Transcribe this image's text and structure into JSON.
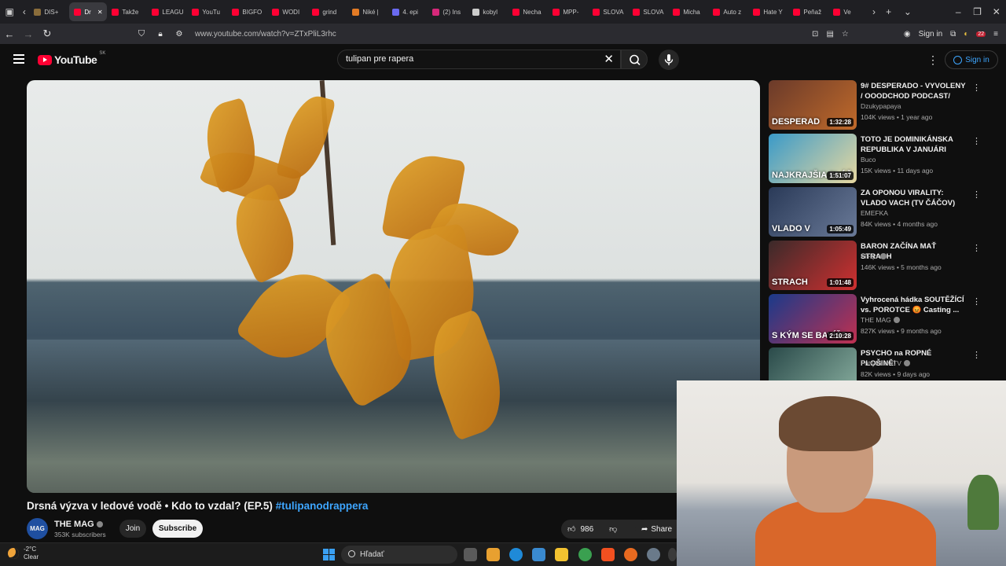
{
  "browser": {
    "tabs": [
      {
        "label": "DIS+",
        "color": "#8a6d3b"
      },
      {
        "label": "Dr",
        "color": "#ff0033",
        "active": true
      },
      {
        "label": "Takže",
        "color": "#ff0033"
      },
      {
        "label": "LEAGU",
        "color": "#ff0033"
      },
      {
        "label": "YouTu",
        "color": "#ff0033"
      },
      {
        "label": "BIGFO",
        "color": "#ff0033"
      },
      {
        "label": "WODI",
        "color": "#ff0033"
      },
      {
        "label": "grind",
        "color": "#ff0033"
      },
      {
        "label": "Niké |",
        "color": "#e37b25"
      },
      {
        "label": "4. epi",
        "color": "#6a6af0"
      },
      {
        "label": "(2) Ins",
        "color": "#d6287a"
      },
      {
        "label": "kobyl",
        "color": "#cccccc"
      },
      {
        "label": "Necha",
        "color": "#ff0033"
      },
      {
        "label": "MPP-",
        "color": "#ff0033"
      },
      {
        "label": "SLOVA",
        "color": "#ff0033"
      },
      {
        "label": "SLOVA",
        "color": "#ff0033"
      },
      {
        "label": "Micha",
        "color": "#ff0033"
      },
      {
        "label": "Auto z",
        "color": "#ff0033"
      },
      {
        "label": "Hate Y",
        "color": "#ff0033"
      },
      {
        "label": "Peňaž",
        "color": "#ff0033"
      },
      {
        "label": "Ve",
        "color": "#ff0033"
      }
    ],
    "url": "www.youtube.com/watch?v=ZTxPliL3rhc",
    "signin_label": "Sign in",
    "badge_count": "22"
  },
  "youtube": {
    "logo_text": "YouTube",
    "region": "SK",
    "search_query": "tulipan pre rapera",
    "signin_label": "Sign in"
  },
  "video": {
    "title": "Drsná výzva v ledové vodě • Kdo to vzdal? (EP.5)",
    "hashtag": "#tulipanodrappera",
    "channel": "THE MAG",
    "channel_avatar_text": "MAG",
    "subscribers": "353K subscribers",
    "join_label": "Join",
    "subscribe_label": "Subscribe",
    "likes": "986",
    "share_label": "Share"
  },
  "recommendations": [
    {
      "title": "9# DESPERADO - VYVOLENY / OOODCHOD PODCAST/",
      "channel": "Dzukypapaya",
      "meta": "104K views • 1 year ago",
      "duration": "1:32:28",
      "overlay": "DESPERAD",
      "thumb": [
        "#6a3a2a",
        "#c06a2a"
      ],
      "verified": false
    },
    {
      "title": "TOTO JE DOMINIKÁNSKA REPUBLIKA V JANUÁRI",
      "channel": "Buco",
      "meta": "15K views • 11 days ago",
      "duration": "1:51:07",
      "overlay": "NAJKRAJŠIA PLÁŽ",
      "thumb": [
        "#3a9ac8",
        "#e8d8a0"
      ],
      "verified": false
    },
    {
      "title": "ZA OPONOU VIRALITY: VLADO VACH (TV ČÁČOV)",
      "channel": "EMEFKA",
      "meta": "84K views • 4 months ago",
      "duration": "1:05:49",
      "overlay": "VLADO V",
      "thumb": [
        "#2a3a58",
        "#6a7a98"
      ],
      "verified": false
    },
    {
      "title": "BARON ZAČÍNA MAŤ STRACH",
      "channel": "FiFqo",
      "meta": "146K views • 5 months ago",
      "duration": "1:01:48",
      "overlay": "STRACH",
      "thumb": [
        "#3a2a2a",
        "#d03030"
      ],
      "verified": true
    },
    {
      "title": "Vyhrocená hádka SOUTĚŽÍCÍ vs. POROTCE 😡 Casting ...",
      "channel": "THE MAG",
      "meta": "827K views • 9 months ago",
      "duration": "2:10:28",
      "overlay": "S KÝM SE BAVÍŠ?",
      "thumb": [
        "#1a3a8a",
        "#c03050"
      ],
      "verified": true
    },
    {
      "title": "PSYCHO na ROPNÉ PLOŠINĚ!",
      "channel": "FattyPillowTV",
      "meta": "82K views • 9 days ago",
      "duration": "",
      "overlay": "",
      "thumb": [
        "#2a4a4a",
        "#8ab0a0"
      ],
      "verified": true
    }
  ],
  "taskbar": {
    "temperature": "-2°C",
    "condition": "Clear",
    "search_placeholder": "Hľadať"
  }
}
